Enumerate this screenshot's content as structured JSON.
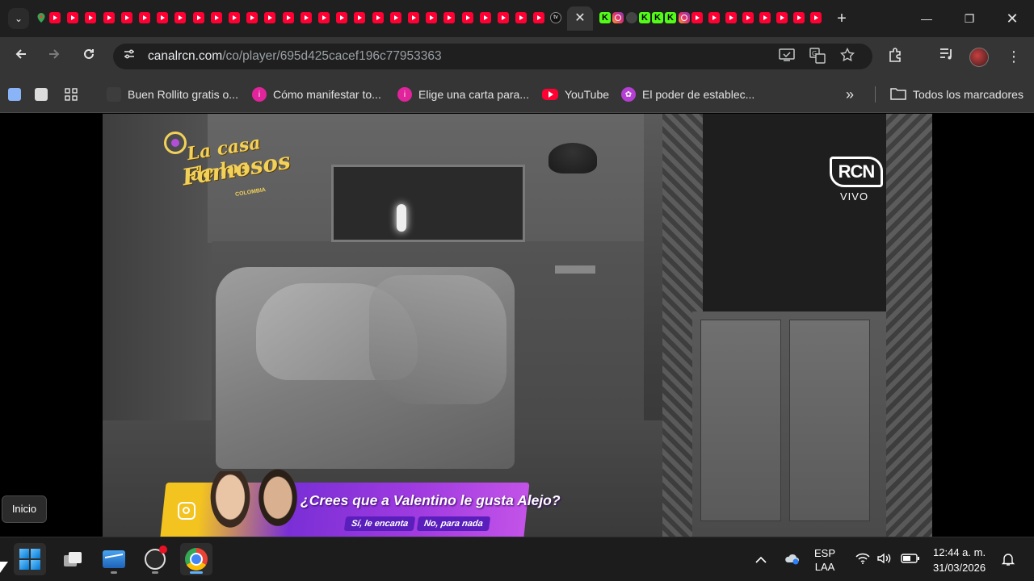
{
  "browser": {
    "tabs": {
      "active_close": "✕",
      "new_tab": "+",
      "tv_favicon_text": "tv",
      "kick_favicon_text": "K"
    },
    "window_controls": {
      "minimize": "—",
      "restore": "❐",
      "close": "✕"
    },
    "address_bar": {
      "host": "canalrcn.com",
      "path": "/co/player/695d425cacef196c77953363"
    },
    "bookmarks": [
      {
        "label": "Buen Rollito gratis o...",
        "favicon": "generic-icon"
      },
      {
        "label": "Cómo manifestar to...",
        "favicon": "pink-info-icon"
      },
      {
        "label": "Elige una carta para...",
        "favicon": "pink-info-icon"
      },
      {
        "label": "YouTube",
        "favicon": "youtube-icon"
      },
      {
        "label": "El poder de establec...",
        "favicon": "purple-flower-icon"
      }
    ],
    "bookmarks_overflow": "»",
    "all_bookmarks": "Todos los marcadores"
  },
  "video": {
    "show_logo_line1": "La casa de los",
    "show_logo_line2": "Famosos",
    "show_logo_line3": "COLOMBIA",
    "channel_logo": "RCN",
    "live_label": "VIVO",
    "poll": {
      "question": "¿Crees que a Valentino le gusta Alejo?",
      "option_yes": "Sí, le encanta",
      "option_no": "No, para nada"
    }
  },
  "tooltip": {
    "start": "Inicio"
  },
  "taskbar": {
    "language_line1": "ESP",
    "language_line2": "LAA",
    "time": "12:44 a. m.",
    "date": "31/03/2026",
    "tray_overflow": "^"
  }
}
